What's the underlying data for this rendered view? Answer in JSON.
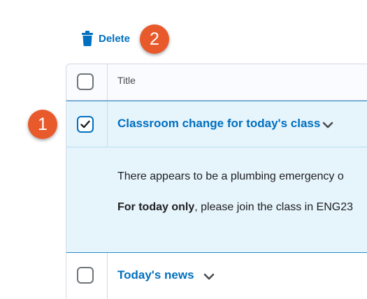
{
  "toolbar": {
    "delete_label": "Delete",
    "delete_icon": "trash-icon"
  },
  "callouts": {
    "badge_1": "1",
    "badge_2": "2",
    "color": "#e85a2b"
  },
  "table": {
    "column_header": "Title",
    "rows": [
      {
        "title": "Classroom change for today's class",
        "selected": true,
        "expanded": true,
        "body_line_1": "There appears to be a plumbing emergency o",
        "body_line_2_bold": "For today only",
        "body_line_2_rest": ", please join the class in ENG23"
      },
      {
        "title": "Today's news",
        "selected": false,
        "expanded": false
      }
    ]
  },
  "colors": {
    "link": "#006fbf",
    "selected_bg": "#e6f4fc",
    "selected_border": "#2c8ac6",
    "grid_line": "#d3d9e3"
  }
}
